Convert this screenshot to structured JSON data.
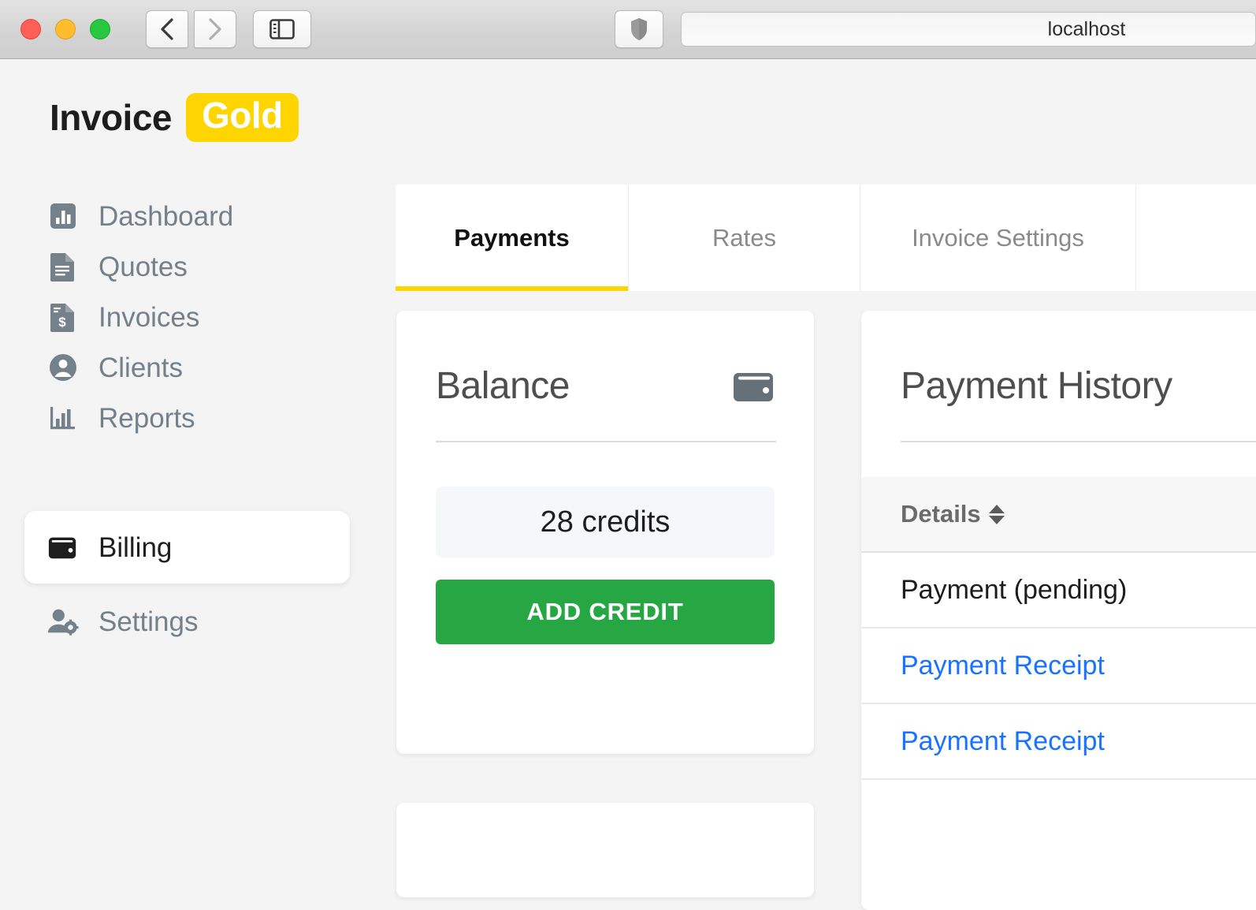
{
  "browser": {
    "url": "localhost",
    "back_icon": "chevron-left-icon",
    "forward_icon": "chevron-right-icon",
    "sidebar_icon": "sidebar-toggle-icon",
    "shield_icon": "shield-icon",
    "traffic_lights": [
      "close",
      "minimize",
      "zoom"
    ]
  },
  "branding": {
    "name": "Invoice",
    "badge": "Gold",
    "badge_color": "#ffd500",
    "accent_color": "#ffd500"
  },
  "sidebar": {
    "items": [
      {
        "label": "Dashboard",
        "icon": "chart-bar-square-icon",
        "active": false
      },
      {
        "label": "Quotes",
        "icon": "document-icon",
        "active": false
      },
      {
        "label": "Invoices",
        "icon": "document-dollar-icon",
        "active": false
      },
      {
        "label": "Clients",
        "icon": "user-circle-icon",
        "active": false
      },
      {
        "label": "Reports",
        "icon": "bar-chart-icon",
        "active": false
      },
      {
        "label": "Billing",
        "icon": "wallet-icon",
        "active": true
      },
      {
        "label": "Settings",
        "icon": "user-gear-icon",
        "active": false
      }
    ]
  },
  "tabs": [
    {
      "label": "Payments",
      "active": true
    },
    {
      "label": "Rates",
      "active": false
    },
    {
      "label": "Invoice Settings",
      "active": false
    },
    {
      "label": "",
      "active": false
    }
  ],
  "balance_card": {
    "title": "Balance",
    "icon": "wallet-icon",
    "value": "28 credits",
    "button_label": "ADD CREDIT",
    "button_color": "#27a744"
  },
  "history_card": {
    "title": "Payment History",
    "columns": [
      {
        "label": "Details",
        "sortable": true,
        "sort_icon": "sort-updown-icon"
      }
    ],
    "rows": [
      {
        "details": "Payment (pending)",
        "is_link": false
      },
      {
        "details": "Payment Receipt",
        "is_link": true
      },
      {
        "details": "Payment Receipt",
        "is_link": true
      }
    ],
    "link_color": "#1a73ff"
  }
}
